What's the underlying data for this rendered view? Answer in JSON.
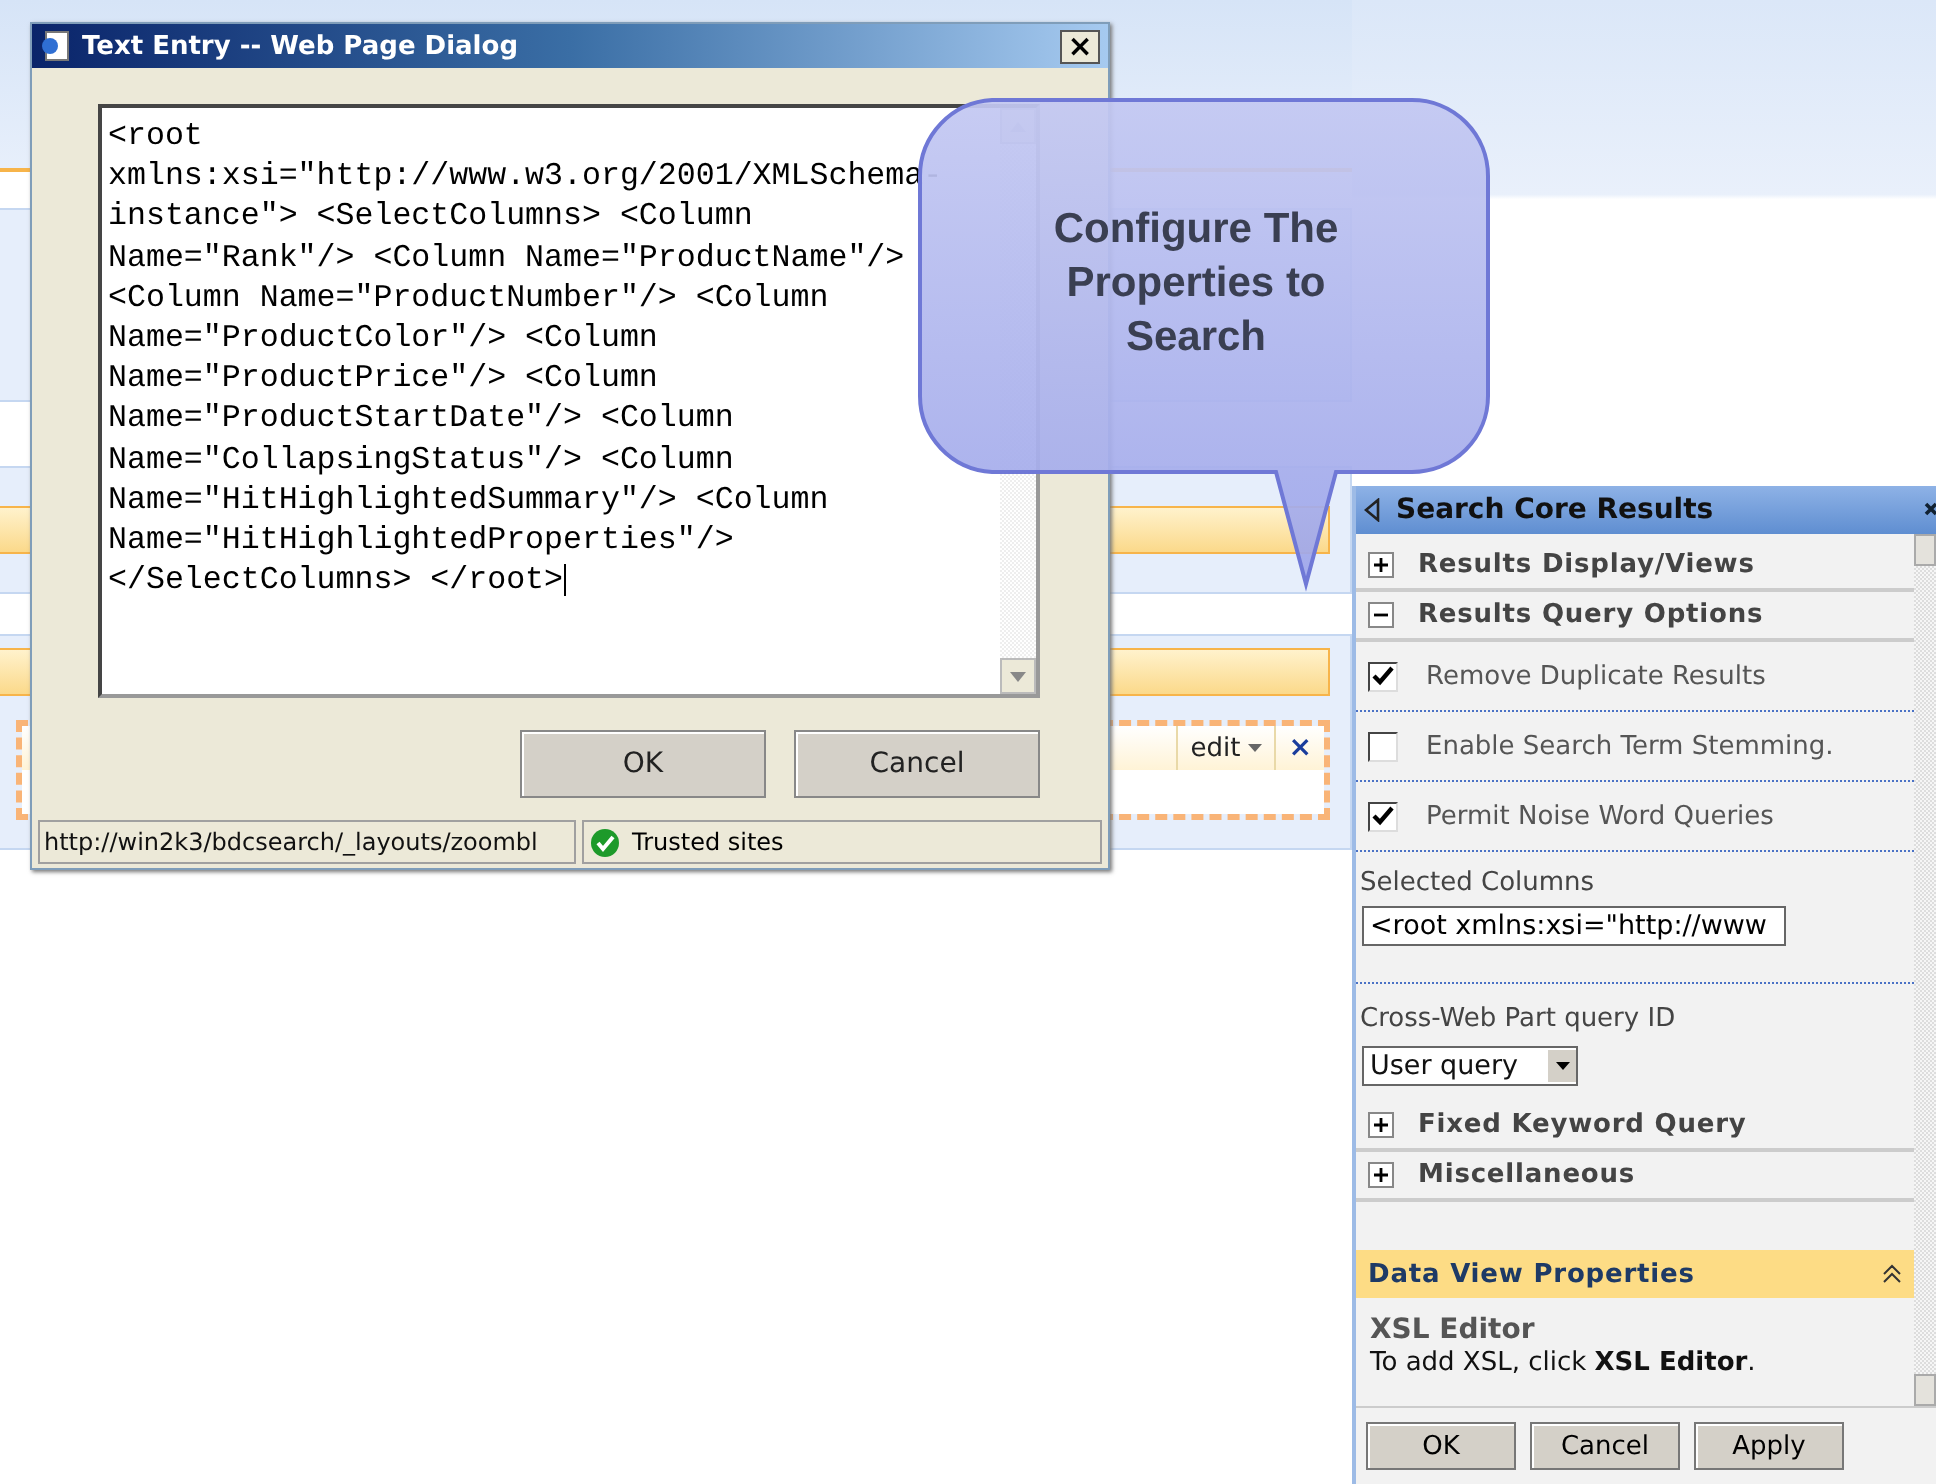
{
  "page": {
    "webpart_toolbar": {
      "edit": "edit",
      "close": "×"
    }
  },
  "dialog": {
    "title": "Text Entry -- Web Page Dialog",
    "close": "×",
    "text": "<root xmlns:xsi=\"http://www.w3.org/2001/XMLSchema-instance\"> <SelectColumns> <Column Name=\"Rank\"/> <Column Name=\"ProductName\"/> <Column Name=\"ProductNumber\"/> <Column Name=\"ProductColor\"/> <Column Name=\"ProductPrice\"/> <Column Name=\"ProductStartDate\"/> <Column Name=\"CollapsingStatus\"/> <Column Name=\"HitHighlightedSummary\"/> <Column Name=\"HitHighlightedProperties\"/> </SelectColumns> </root>",
    "buttons": [
      "OK",
      "Cancel"
    ],
    "status_bar": {
      "url": "http://win2k3/bdcsearch/_layouts/zoombl",
      "zone": "Trusted sites"
    }
  },
  "callout": {
    "text": "Configure The Properties to Search"
  },
  "tool_pane": {
    "title": "Search Core Results",
    "items": [
      {
        "kind": "section",
        "label": "Results Display/Views",
        "expanded": false
      },
      {
        "kind": "section",
        "label": "Results Query Options",
        "expanded": true
      },
      {
        "kind": "checkbox",
        "label": "Remove Duplicate Results",
        "checked": true
      },
      {
        "kind": "checkbox",
        "label": "Enable Search Term Stemming.",
        "checked": false
      },
      {
        "kind": "checkbox",
        "label": "Permit Noise Word Queries",
        "checked": true
      },
      {
        "kind": "field",
        "label": "Selected Columns",
        "value": "<root xmlns:xsi=\"http://www"
      },
      {
        "kind": "select",
        "label": "Cross-Web Part query ID",
        "value": "User query"
      },
      {
        "kind": "section",
        "label": "Fixed Keyword Query",
        "expanded": false
      },
      {
        "kind": "section",
        "label": "Miscellaneous",
        "expanded": false
      },
      {
        "kind": "group",
        "label": "Data View Properties",
        "expanded": true
      },
      {
        "kind": "text",
        "heading": "XSL Editor",
        "description": "To add XSL, click **XSL Editor**."
      }
    ],
    "buttons": [
      "OK",
      "Cancel",
      "Apply"
    ]
  }
}
